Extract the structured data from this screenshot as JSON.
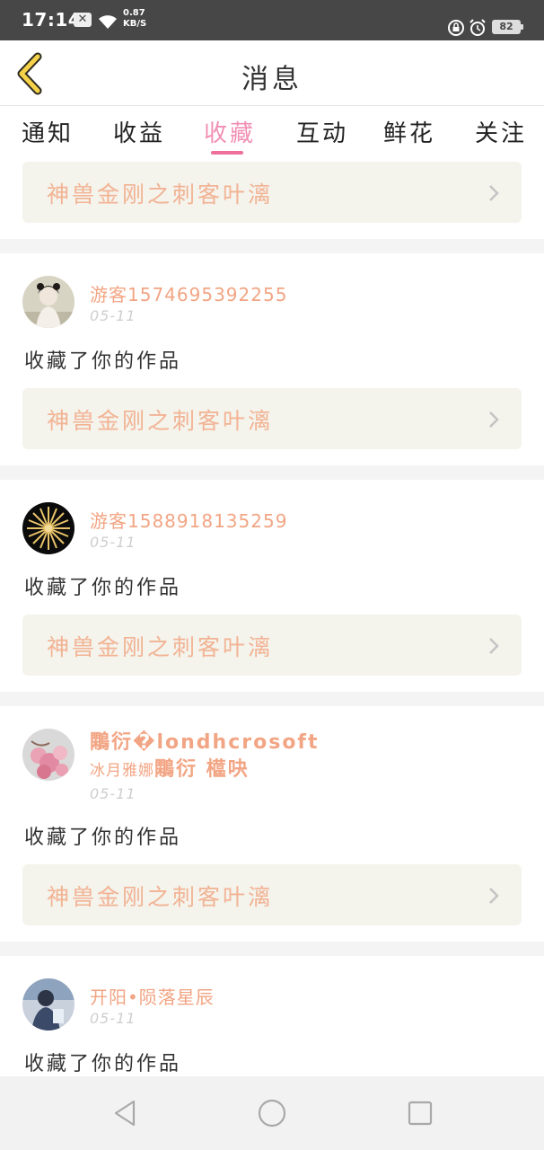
{
  "status_bar": {
    "time": "17:14",
    "notification_icon": "x-box-icon",
    "speed_value": "0.87",
    "speed_unit": "KB/S",
    "battery": "82"
  },
  "header": {
    "title": "消息",
    "back_icon": "chevron-left-icon"
  },
  "tabs": [
    {
      "label": "通知",
      "active": false
    },
    {
      "label": "收益",
      "active": false
    },
    {
      "label": "收藏",
      "active": true
    },
    {
      "label": "互动",
      "active": false
    },
    {
      "label": "鲜花",
      "active": false
    },
    {
      "label": "关注",
      "active": false
    }
  ],
  "top_card": {
    "title": "神兽金刚之刺客叶漓"
  },
  "messages": [
    {
      "user": "游客1574695392255",
      "date": "05-11",
      "action": "收藏了你的作品",
      "work_title": "神兽金刚之刺客叶漓",
      "avatar": "woman-portrait-avatar"
    },
    {
      "user": "游客1588918135259",
      "date": "05-11",
      "action": "收藏了你的作品",
      "work_title": "神兽金刚之刺客叶漓",
      "avatar": "dark-sunburst-avatar"
    },
    {
      "user_part1": "鷴衍�londhcrosoft",
      "user_part2": "冰月雅娜",
      "user_part3": "鷴衍",
      "user_line2": "櫙吷",
      "date": "05-11",
      "action": "收藏了你的作品",
      "work_title": "神兽金刚之刺客叶漓",
      "avatar": "pink-flowers-avatar"
    },
    {
      "user": "开阳•陨落星辰",
      "date": "05-11",
      "action": "收藏了你的作品",
      "avatar": "blue-figure-avatar"
    }
  ],
  "colors": {
    "accent_pink": "#ee6e9c",
    "username_orange": "#f2a584",
    "work_title_peach": "#f2b394",
    "card_bg": "#f4f3ec",
    "back_icon_yellow": "#f6d24a"
  },
  "nav": {
    "back": "triangle-back-icon",
    "home": "circle-home-icon",
    "recent": "square-recent-icon"
  }
}
